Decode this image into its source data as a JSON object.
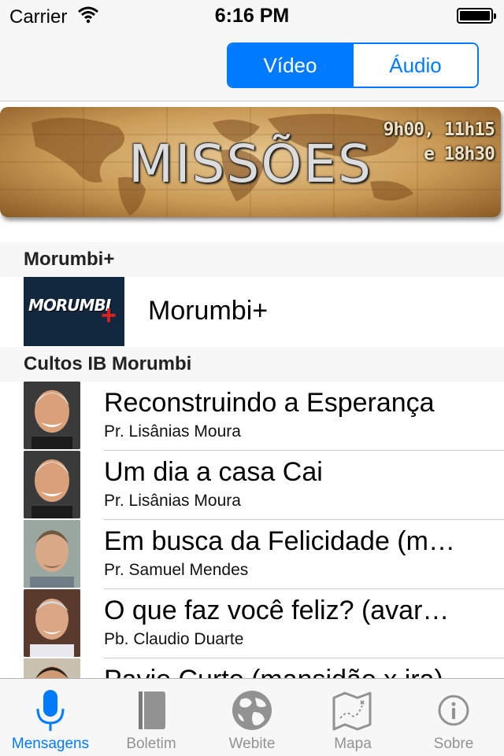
{
  "status_bar": {
    "carrier": "Carrier",
    "time": "6:16 PM"
  },
  "nav": {
    "segments": [
      "Vídeo",
      "Áudio"
    ],
    "selected": "Vídeo"
  },
  "banner": {
    "title": "MISSÕES",
    "times_line1": "9h00, 11h15",
    "times_line2": "e 18h30"
  },
  "sections": [
    {
      "header": "Morumbi+",
      "items": [
        {
          "title": "Morumbi+",
          "thumb_text": "MORUMBI",
          "thumb_plus": "+"
        }
      ]
    },
    {
      "header": "Cultos IB Morumbi",
      "items": [
        {
          "title": "Reconstruindo a Esperança",
          "subtitle": "Pr. Lisânias Moura"
        },
        {
          "title": "Um dia a casa Cai",
          "subtitle": "Pr. Lisânias Moura"
        },
        {
          "title": "Em busca da Felicidade (m…",
          "subtitle": "Pr. Samuel Mendes"
        },
        {
          "title": "O que faz você feliz? (avar…",
          "subtitle": "Pb. Claudio Duarte"
        },
        {
          "title": "Pavio Curto (mansidão x ira)",
          "subtitle": ""
        }
      ]
    }
  ],
  "tabs": [
    {
      "label": "Mensagens",
      "icon": "microphone-icon",
      "active": true
    },
    {
      "label": "Boletim",
      "icon": "book-icon",
      "active": false
    },
    {
      "label": "Webite",
      "icon": "globe-icon",
      "active": false
    },
    {
      "label": "Mapa",
      "icon": "map-icon",
      "active": false
    },
    {
      "label": "Sobre",
      "icon": "info-icon",
      "active": false
    }
  ],
  "colors": {
    "accent": "#007aff",
    "inactive_tab": "#929292",
    "separator": "#c8c7cc"
  }
}
